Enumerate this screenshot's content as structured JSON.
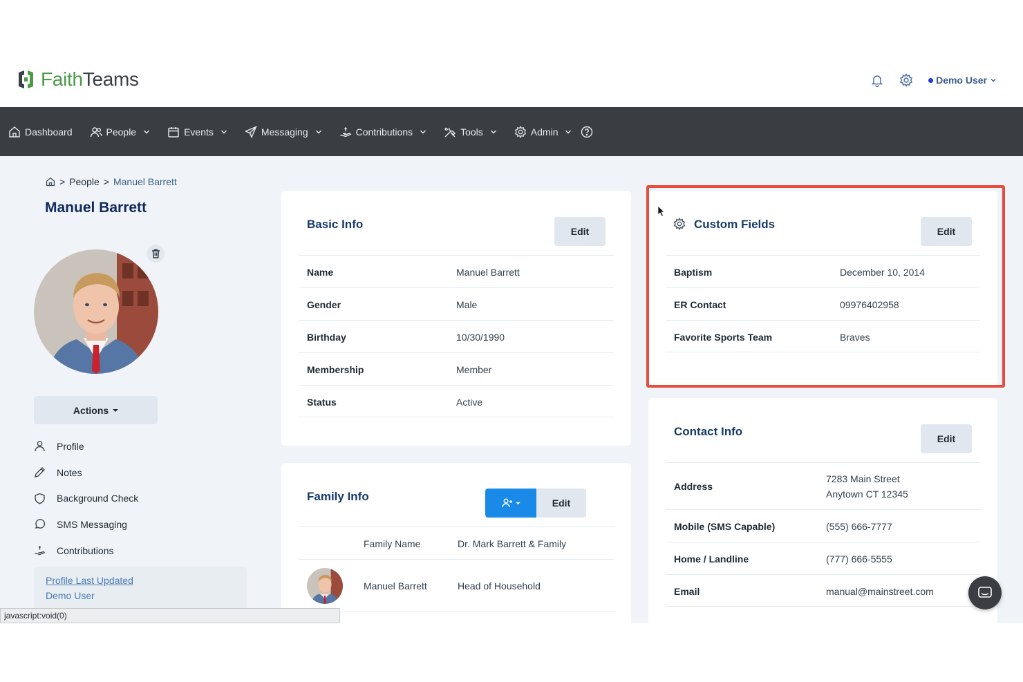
{
  "app": {
    "logo_faith": "Faith",
    "logo_teams": "Teams",
    "user": "Demo User"
  },
  "nav": [
    {
      "label": "Dashboard",
      "icon": "home-icon",
      "dropdown": false
    },
    {
      "label": "People",
      "icon": "users-icon",
      "dropdown": true
    },
    {
      "label": "Events",
      "icon": "calendar-icon",
      "dropdown": true
    },
    {
      "label": "Messaging",
      "icon": "send-icon",
      "dropdown": true
    },
    {
      "label": "Contributions",
      "icon": "hand-coin-icon",
      "dropdown": true
    },
    {
      "label": "Tools",
      "icon": "tools-icon",
      "dropdown": true
    },
    {
      "label": "Admin",
      "icon": "gear-icon",
      "dropdown": true
    }
  ],
  "breadcrumb": {
    "sep1": ">",
    "people": "People",
    "sep2": ">",
    "current": "Manuel Barrett"
  },
  "person": {
    "name": "Manuel Barrett",
    "actions_label": "Actions",
    "menu": [
      "Profile",
      "Notes",
      "Background Check",
      "SMS Messaging",
      "Contributions"
    ],
    "updated_link": "Profile Last Updated",
    "updated_by": "Demo User"
  },
  "basic_info": {
    "title": "Basic Info",
    "edit": "Edit",
    "rows": [
      {
        "label": "Name",
        "value": "Manuel Barrett"
      },
      {
        "label": "Gender",
        "value": "Male"
      },
      {
        "label": "Birthday",
        "value": "10/30/1990"
      },
      {
        "label": "Membership",
        "value": "Member"
      },
      {
        "label": "Status",
        "value": "Active"
      }
    ]
  },
  "custom_fields": {
    "title": "Custom Fields",
    "edit": "Edit",
    "rows": [
      {
        "label": "Baptism",
        "value": "December 10, 2014"
      },
      {
        "label": "ER Contact",
        "value": "09976402958"
      },
      {
        "label": "Favorite Sports Team",
        "value": "Braves"
      }
    ],
    "highlight_color": "#e74c3c"
  },
  "family_info": {
    "title": "Family Info",
    "edit": "Edit",
    "family_name_label": "Family Name",
    "family_name_value": "Dr. Mark Barrett & Family",
    "member_name": "Manuel Barrett",
    "member_role": "Head of Household"
  },
  "contact_info": {
    "title": "Contact Info",
    "edit": "Edit",
    "address_label": "Address",
    "address_line1": "7283 Main Street",
    "address_line2": "Anytown CT 12345",
    "rows": [
      {
        "label": "Mobile (SMS Capable)",
        "value": "(555) 666-7777"
      },
      {
        "label": "Home / Landline",
        "value": "(777) 666-5555"
      },
      {
        "label": "Email",
        "value": "manual@mainstreet.com"
      }
    ]
  },
  "statusbar": "javascript:void(0)",
  "colors": {
    "nav_bg": "#3a3d42",
    "accent_blue": "#1a8ae8",
    "title_navy": "#163a6b",
    "logo_green": "#4a9b47"
  }
}
